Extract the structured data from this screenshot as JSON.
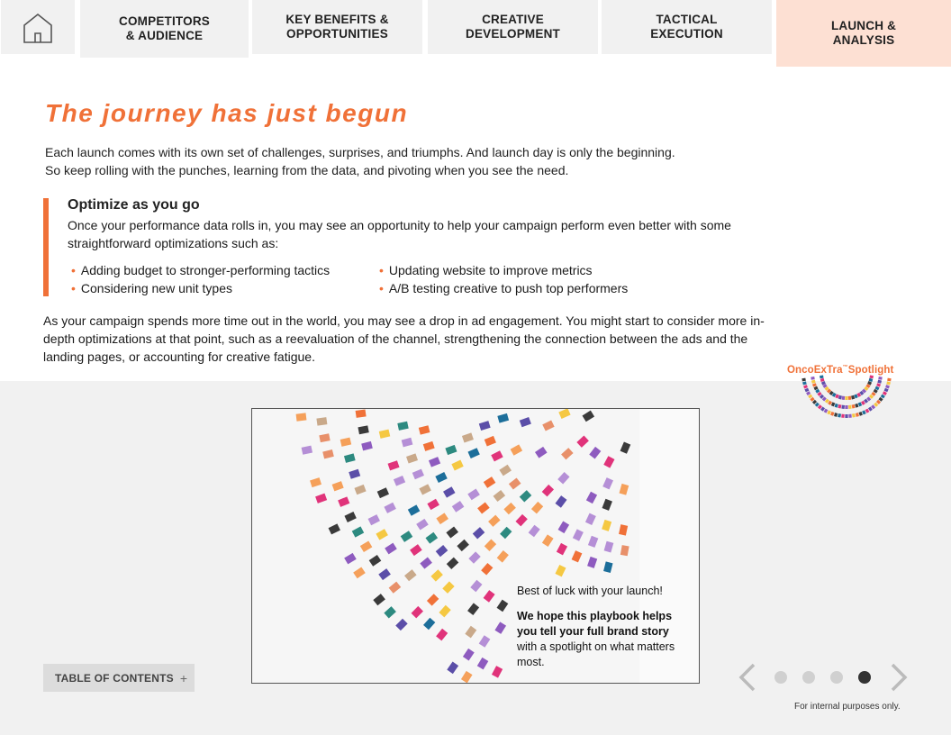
{
  "nav": {
    "tabs": [
      {
        "label": "COMPETITORS\n& AUDIENCE",
        "active": false
      },
      {
        "label": "KEY BENEFITS &\nOPPORTUNITIES",
        "active": false
      },
      {
        "label": "CREATIVE\nDEVELOPMENT",
        "active": false
      },
      {
        "label": "TACTICAL\nEXECUTION",
        "active": false
      },
      {
        "label": "LAUNCH &\nANALYSIS",
        "active": true
      }
    ]
  },
  "content": {
    "title": "The journey has just begun",
    "intro_line1": "Each launch comes with its own set of challenges, surprises, and triumphs. And launch day is only the beginning.",
    "intro_line2": "So keep rolling with the punches, learning from the data, and pivoting when you see the need.",
    "optimize_heading": "Optimize as you go",
    "optimize_desc": "Once your performance data rolls in, you may see an opportunity to help your campaign perform even better with some straightforward optimizations such as:",
    "bullets": [
      "Adding budget to stronger-performing tactics",
      "Considering new unit types",
      "Updating website to improve metrics",
      "A/B testing creative to push top performers"
    ],
    "paragraph": "As your campaign spends more time out in the world, you may see a drop in ad engagement. You might start to consider more in-depth optimizations at that point, such as a reevaluation of the channel, strengthening the connection between the ads and the landing pages, or accounting for creative fatigue."
  },
  "logo": {
    "name": "OncoExTra",
    "tm": "™",
    "suffix": "Spotlight"
  },
  "image_card": {
    "lead": "Best of luck with your launch!",
    "strong": "We hope this playbook helps you tell your full brand story",
    "rest": "with a spotlight on what matters most."
  },
  "toc": {
    "label": "TABLE OF CONTENTS",
    "icon": "+"
  },
  "pager": {
    "total": 4,
    "current": 4
  },
  "footer": "For internal purposes only.",
  "colors": {
    "accent": "#f07138",
    "active_tab": "#fde0d3",
    "tab_bg": "#f1f1f1"
  }
}
